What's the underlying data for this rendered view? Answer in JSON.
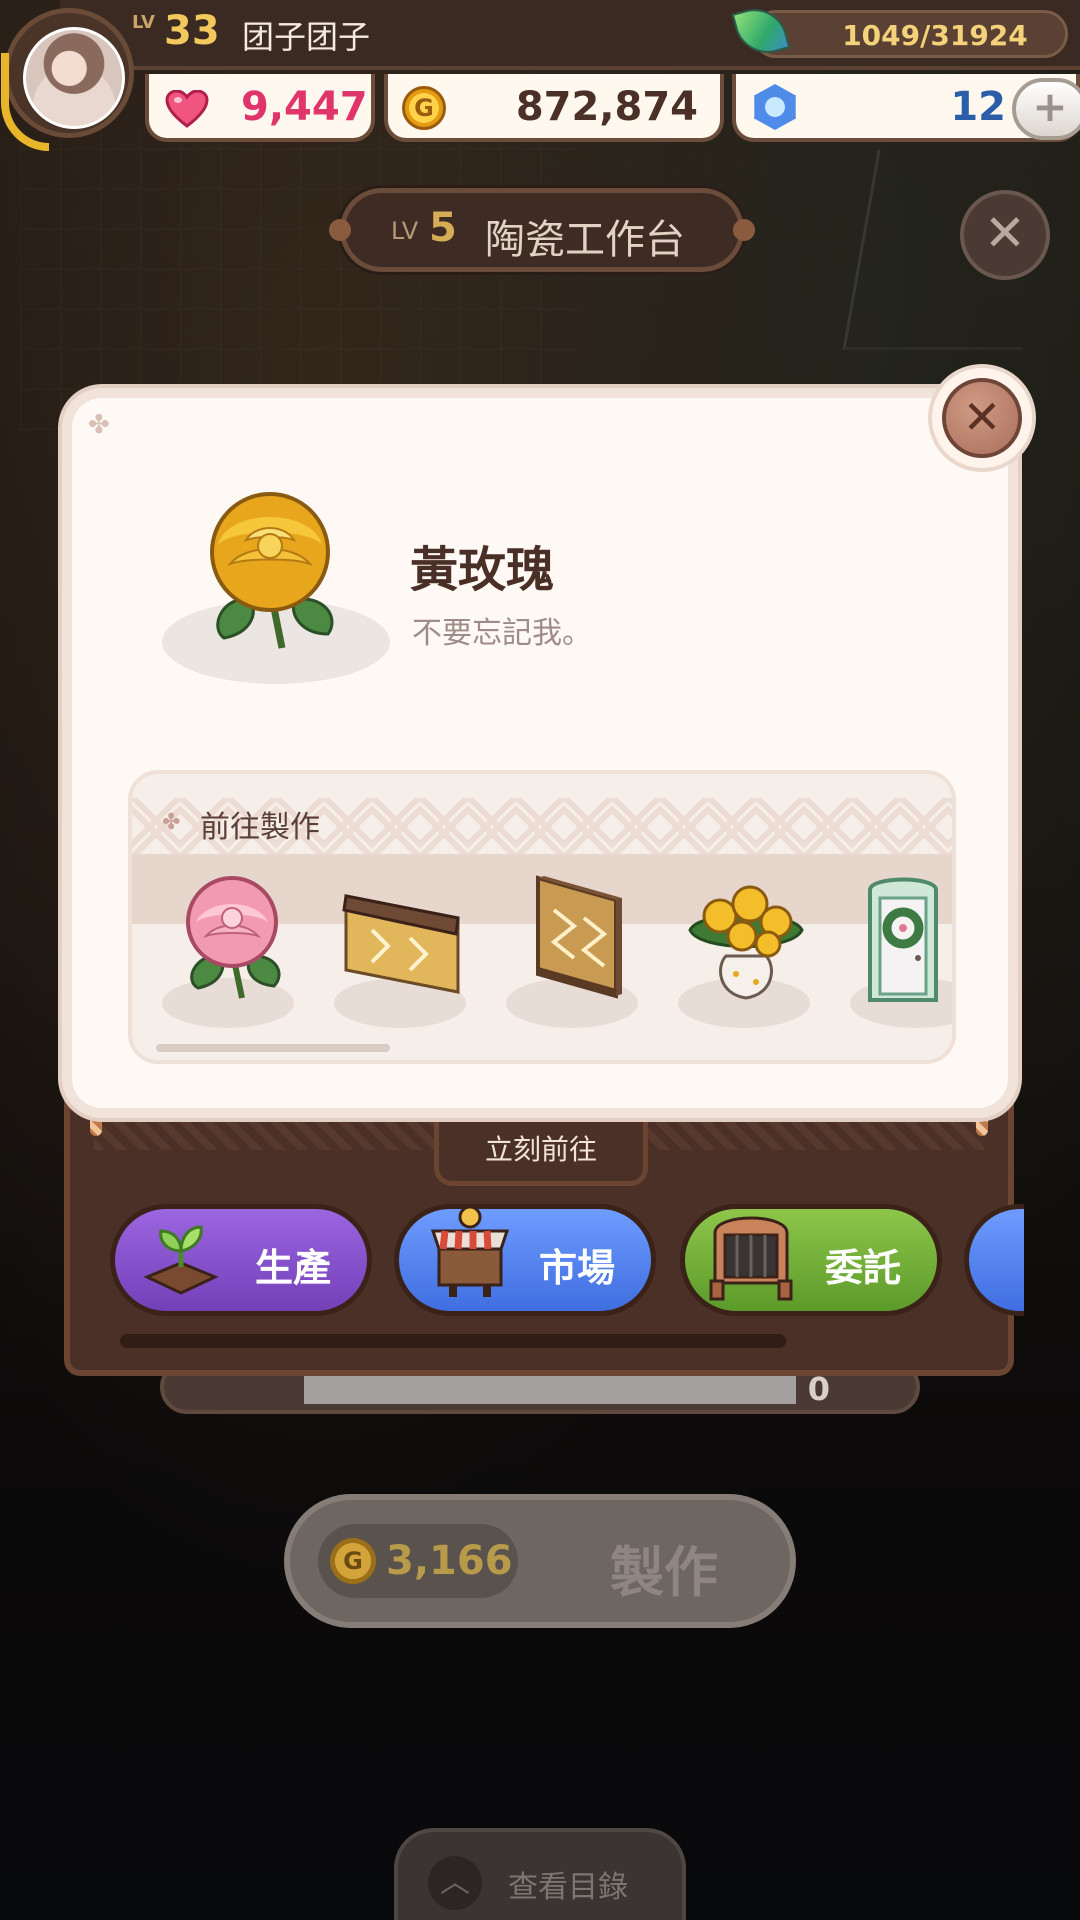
{
  "player": {
    "lv_prefix": "LV",
    "level": "33",
    "name": "团子团子",
    "xp": "1049/31924"
  },
  "currencies": {
    "hearts": "9,447",
    "coins": "872,874",
    "gems": "12",
    "add_label": "+"
  },
  "workstation": {
    "lv_prefix": "LV",
    "level": "5",
    "name": "陶瓷工作台",
    "close_label": "✕"
  },
  "item": {
    "name": "黃玫瑰",
    "description": "不要忘記我。",
    "close_label": "✕"
  },
  "craft_section": {
    "title": "前往製作",
    "items": [
      {
        "icon": "pink-rose-icon"
      },
      {
        "icon": "wooden-counter-icon"
      },
      {
        "icon": "woven-panel-icon"
      },
      {
        "icon": "yellow-rose-vase-icon"
      },
      {
        "icon": "wreath-door-icon"
      }
    ]
  },
  "go_now_label": "立刻前往",
  "destinations": [
    {
      "label": "生產",
      "icon": "sprout-icon",
      "color": "#8451c8"
    },
    {
      "label": "市場",
      "icon": "market-stall-icon",
      "color": "#4f7ef0"
    },
    {
      "label": "委託",
      "icon": "notice-board-icon",
      "color": "#6fae37"
    }
  ],
  "craft_button": {
    "cost": "3,166",
    "label": "製作",
    "coin_glyph": "G"
  },
  "progress_value": "0",
  "catalog_label": "查看目錄",
  "colors": {
    "hud_brown": "#3b2a22",
    "heart_pink": "#e0356a",
    "gem_blue": "#2c5ea8",
    "level_gold": "#f3c85c"
  }
}
